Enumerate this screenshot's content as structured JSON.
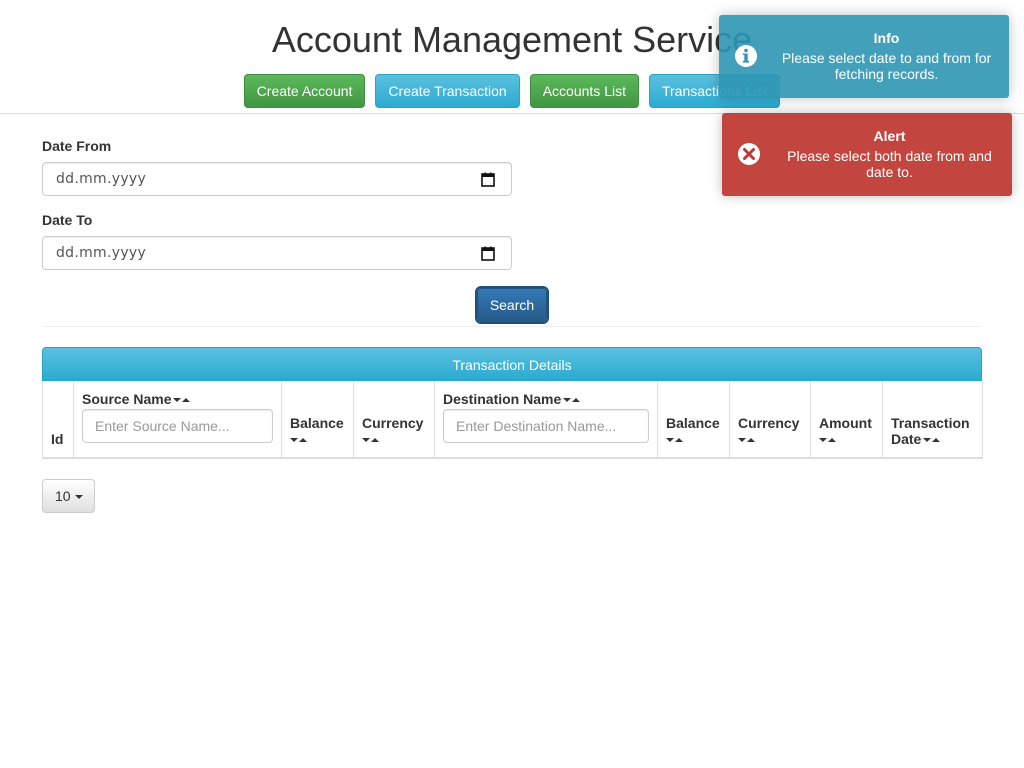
{
  "header": {
    "title": "Account Management Service",
    "nav": {
      "create_account": "Create Account",
      "create_transaction": "Create Transaction",
      "accounts_list": "Accounts List",
      "transactions_list": "Transactions List"
    }
  },
  "form": {
    "date_from_label": "Date From",
    "date_from_value": "dd.mm.yyyy",
    "date_to_label": "Date To",
    "date_to_value": "dd.mm.yyyy",
    "search_label": "Search"
  },
  "panel": {
    "heading": "Transaction Details",
    "columns": {
      "id": "Id",
      "source_name": "Source Name",
      "source_placeholder": "Enter Source Name...",
      "balance": "Balance",
      "currency": "Currency",
      "destination_name": "Destination Name",
      "destination_placeholder": "Enter Destination Name...",
      "dest_balance": "Balance",
      "dest_currency": "Currency",
      "amount": "Amount",
      "transaction_date_1": "Transaction",
      "transaction_date_2": "Date"
    }
  },
  "pagination": {
    "page_size": "10"
  },
  "toasts": {
    "info": {
      "title": "Info",
      "message": "Please select date to and from for fetching records."
    },
    "error": {
      "title": "Alert",
      "message": "Please select both date from and date to."
    }
  },
  "colors": {
    "success": "#5cb85c",
    "info": "#5bc0de",
    "primary": "#337ab7",
    "toast_info": "#2f96b4",
    "toast_error": "#bd362f"
  },
  "icons": {
    "calendar": "calendar-icon",
    "info": "info-circle-icon",
    "error": "times-circle-icon",
    "sort": "sort-caret-icon"
  }
}
